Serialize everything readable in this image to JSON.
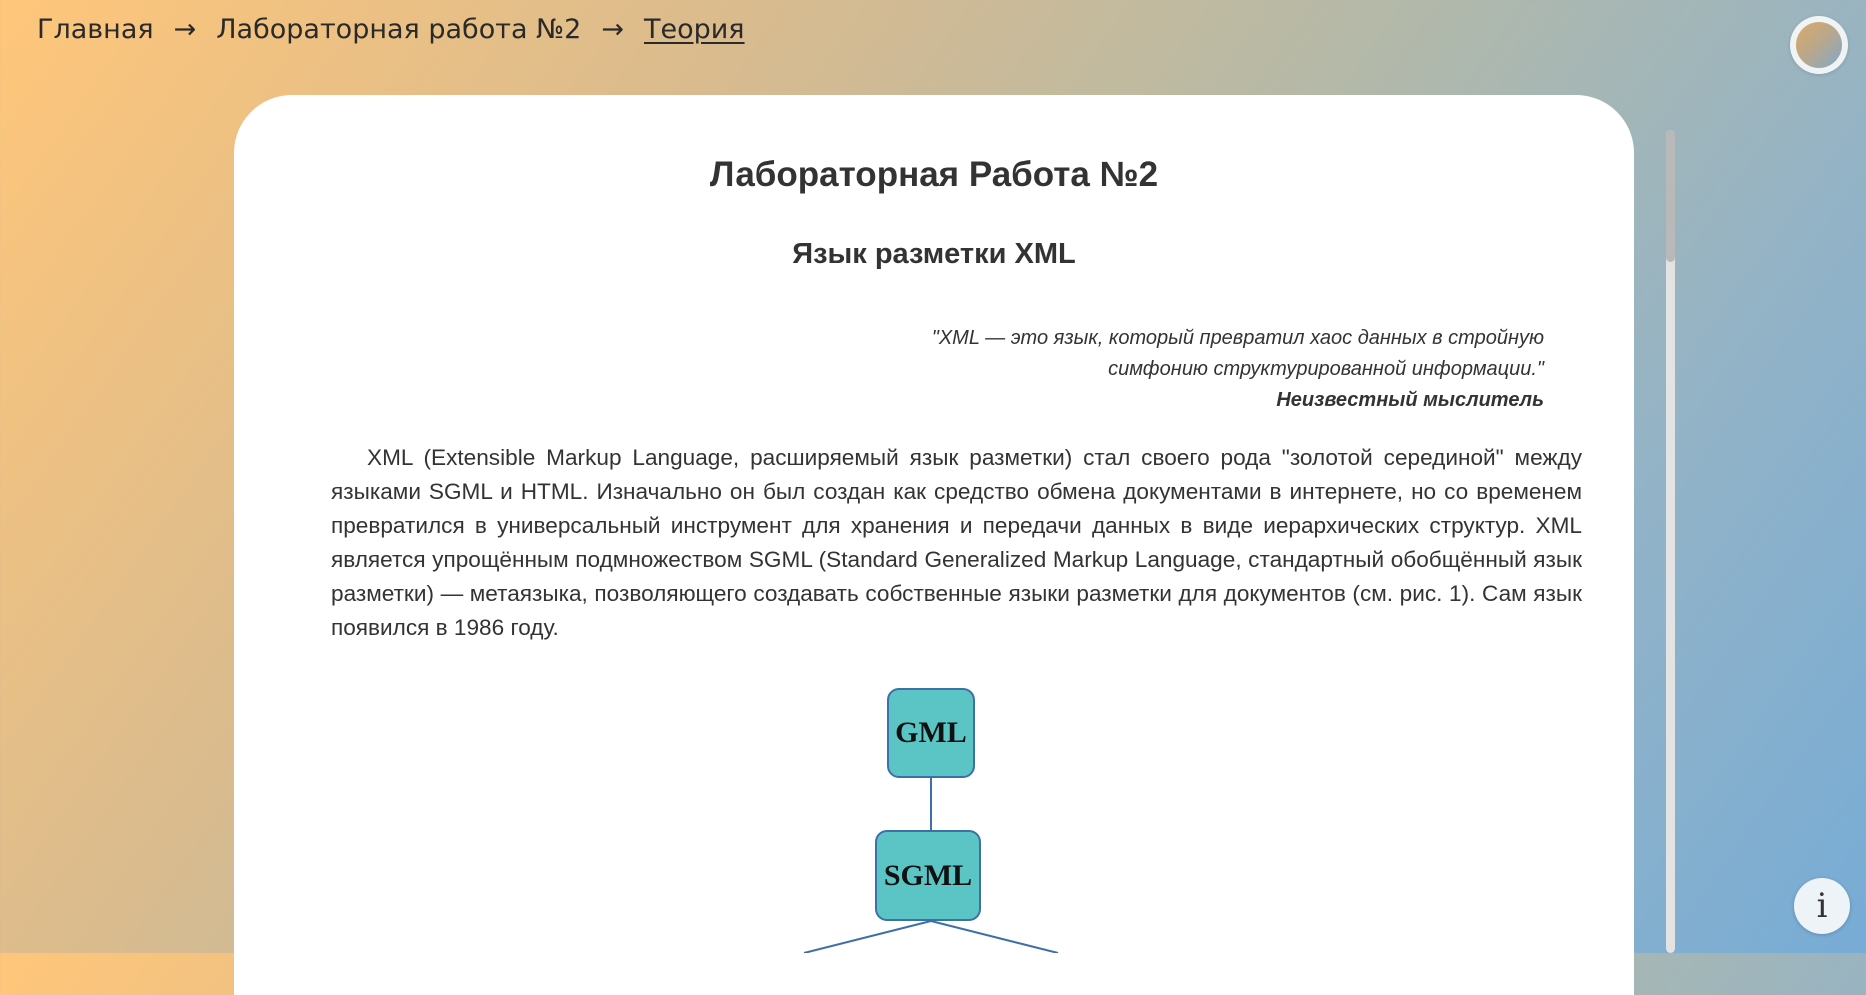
{
  "breadcrumb": {
    "home": "Главная",
    "lab": "Лабораторная работа №2",
    "current": "Теория",
    "separator": "→"
  },
  "page": {
    "title": "Лабораторная Работа №2",
    "subtitle": "Язык разметки XML"
  },
  "quote": {
    "text": "\"XML — это язык, который превратил хаос данных в стройную симфонию структурированной информации.\"",
    "author": "Неизвестный мыслитель"
  },
  "paragraph": "XML (Extensible Markup Language, расширяемый язык разметки) стал своего рода \"золотой серединой\" между языками SGML и HTML. Изначально он был создан как средство обмена документами в интернете, но со временем превратился в универсальный инструмент для хранения и передачи данных в виде иерархических структур. XML является упрощённым подмножеством SGML (Standard Generalized Markup Language, стандартный обобщённый язык разметки) — метаязыка, позволяющего создавать собственные языки разметки для документов (см. рис. 1). Сам язык появился в 1986 году.",
  "diagram": {
    "nodes": [
      "GML",
      "SGML"
    ],
    "node_color": "#5bc4c4",
    "border_color": "#3f6fa8"
  },
  "buttons": {
    "theme_toggle": "theme-toggle-icon",
    "info": "i"
  }
}
